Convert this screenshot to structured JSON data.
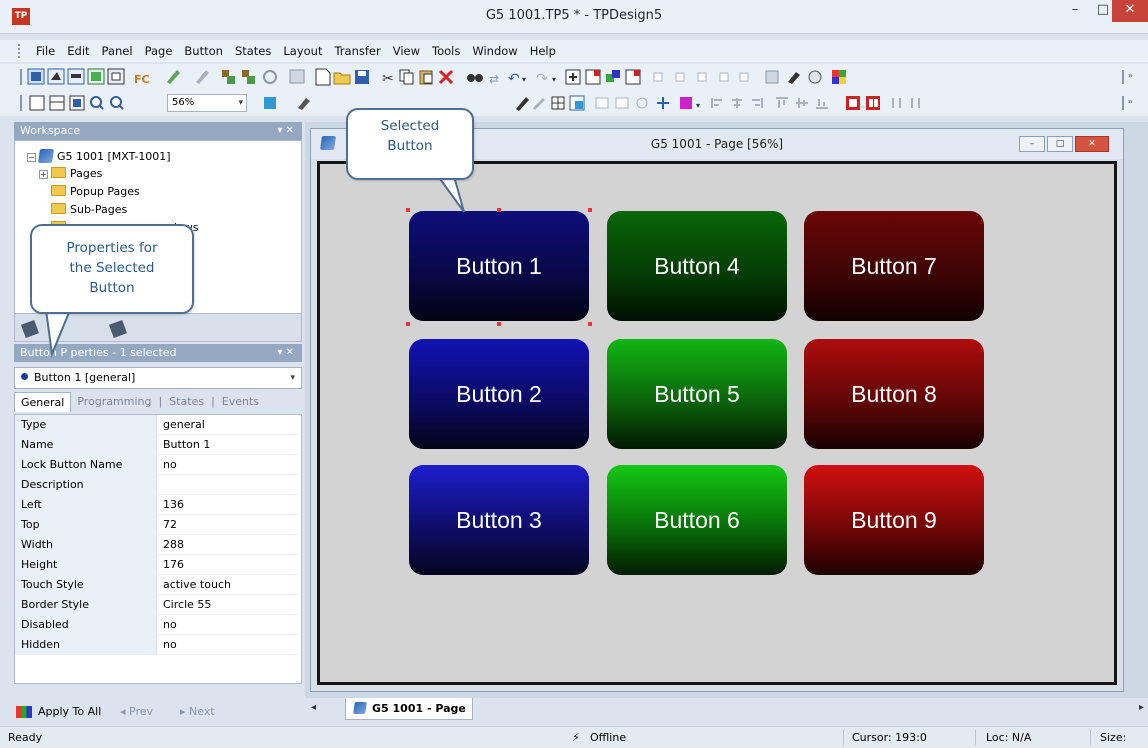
{
  "window": {
    "app_icon": "TP",
    "title": "G5 1001.TP5 * - TPDesign5",
    "minimize": "–",
    "maximize": "□",
    "close": "✕"
  },
  "menu": [
    "File",
    "Edit",
    "Panel",
    "Page",
    "Button",
    "States",
    "Layout",
    "Transfer",
    "View",
    "Tools",
    "Window",
    "Help"
  ],
  "toolbar": {
    "zoom_value": "56%"
  },
  "workspace": {
    "header": "Workspace",
    "header_icons": "▾ ✕",
    "root": "G5 1001 [MXT-1001]",
    "items": [
      "Pages",
      "Popup Pages",
      "Sub-Pages",
      "dows"
    ]
  },
  "button_properties": {
    "header": "Button P  perties - 1 selected",
    "header_icons": "▾ ✕",
    "selected": "Button 1  [general]",
    "tabs": [
      "General",
      "Programming",
      "States",
      "Events"
    ],
    "rows": [
      {
        "name": "Type",
        "value": "general"
      },
      {
        "name": "Name",
        "value": "Button 1"
      },
      {
        "name": "Lock Button Name",
        "value": "no"
      },
      {
        "name": "Description",
        "value": ""
      },
      {
        "name": "Left",
        "value": "136"
      },
      {
        "name": "Top",
        "value": "72"
      },
      {
        "name": "Width",
        "value": "288"
      },
      {
        "name": "Height",
        "value": "176"
      },
      {
        "name": "Touch Style",
        "value": "active touch"
      },
      {
        "name": "Border Style",
        "value": "Circle 55"
      },
      {
        "name": "Disabled",
        "value": "no"
      },
      {
        "name": "Hidden",
        "value": "no"
      }
    ],
    "footer": {
      "apply": "Apply To All",
      "prev": "◂ Prev",
      "next": "▸ Next"
    }
  },
  "document": {
    "title": "G5 1001 - Page  [56%]",
    "buttons": [
      "Button 1",
      "Button 2",
      "Button 3",
      "Button 4",
      "Button 5",
      "Button 6",
      "Button 7",
      "Button 8",
      "Button 9"
    ]
  },
  "callouts": {
    "selected_button": "Selected\nButton",
    "properties": "Properties for\nthe Selected\nButton"
  },
  "page_tab": "G5 1001 - Page",
  "status": {
    "ready": "Ready",
    "connection": "Offline",
    "cursor": "Cursor: 193:0",
    "loc": "Loc:  N/A",
    "size": "Size:"
  },
  "colors": {
    "panel_header": "#95a8c2",
    "callout_border": "#4e6f92",
    "callout_text": "#2a5a8c",
    "close_button": "#c7433a"
  }
}
